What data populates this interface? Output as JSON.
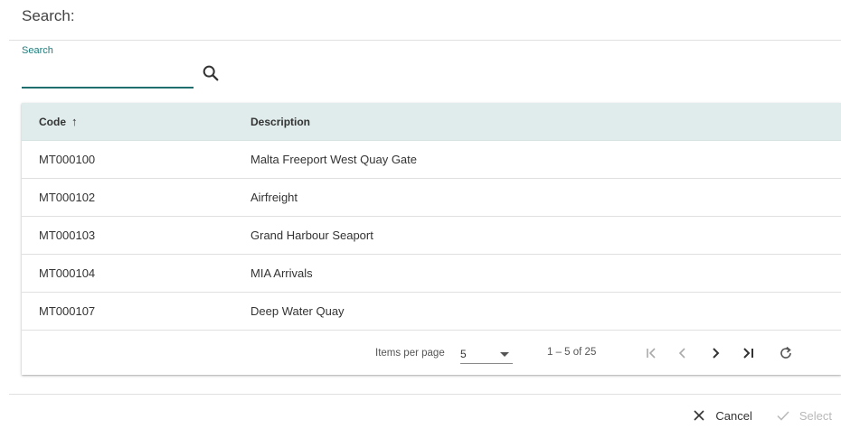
{
  "dialog": {
    "title": "Search:"
  },
  "search": {
    "label": "Search",
    "value": "",
    "icon": "search-icon"
  },
  "table": {
    "columns": {
      "code": "Code",
      "description": "Description"
    },
    "sort": {
      "column": "code",
      "direction": "ascending",
      "icon": "arrow-up-icon"
    },
    "rows": [
      {
        "code": "MT000100",
        "description": "Malta Freeport West Quay Gate"
      },
      {
        "code": "MT000102",
        "description": "Airfreight"
      },
      {
        "code": "MT000103",
        "description": "Grand Harbour Seaport"
      },
      {
        "code": "MT000104",
        "description": "MIA Arrivals"
      },
      {
        "code": "MT000107",
        "description": "Deep Water Quay"
      }
    ],
    "header_color": "#dfeceb"
  },
  "paginator": {
    "items_per_page_label": "Items per page",
    "page_size": "5",
    "range": "1 – 5 of 25"
  },
  "actions": {
    "cancel_label": "Cancel",
    "select_label": "Select"
  },
  "colors": {
    "accent": "#1e7c7b",
    "disabled": "#b8b8b8"
  }
}
